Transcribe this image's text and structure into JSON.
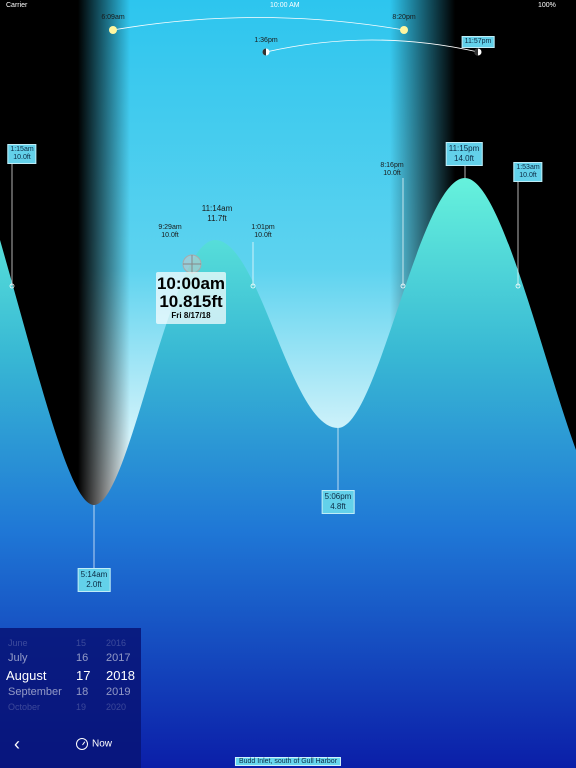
{
  "status_bar": {
    "carrier": "Carrier",
    "time": "10:00 AM",
    "battery": "100%"
  },
  "sun": {
    "rise": "6:09am",
    "set": "8:20pm"
  },
  "moon": {
    "rise": "1:36pm",
    "set": "11:57pm"
  },
  "current": {
    "time": "10:00am",
    "height": "10.815ft",
    "date": "Fri 8/17/18"
  },
  "tide_labels": [
    {
      "name": "mid-left-1",
      "time": "1:15am",
      "height": "10.0ft",
      "box": true
    },
    {
      "name": "mid-2",
      "time": "9:29am",
      "height": "10.0ft",
      "box": false
    },
    {
      "name": "high-1",
      "time": "11:14am",
      "height": "11.7ft",
      "box": false
    },
    {
      "name": "mid-3",
      "time": "1:01pm",
      "height": "10.0ft",
      "box": false
    },
    {
      "name": "mid-4",
      "time": "8:16pm",
      "height": "10.0ft",
      "box": false
    },
    {
      "name": "high-2",
      "time": "11:15pm",
      "height": "14.0ft",
      "box": true
    },
    {
      "name": "mid-5",
      "time": "1:53am",
      "height": "10.0ft",
      "box": true
    },
    {
      "name": "low-1",
      "time": "5:14am",
      "height": "2.0ft",
      "box": true
    },
    {
      "name": "low-2",
      "time": "5:06pm",
      "height": "4.8ft",
      "box": true
    }
  ],
  "picker": {
    "months": [
      "June",
      "July",
      "August",
      "September",
      "October"
    ],
    "days": [
      "15",
      "16",
      "17",
      "18",
      "19"
    ],
    "years": [
      "2016",
      "2017",
      "2018",
      "2019",
      "2020"
    ]
  },
  "nav": {
    "now_label": "Now",
    "back_icon": "chevron-left-icon"
  },
  "station": "Budd Inlet,  south of Gull Harbor"
}
